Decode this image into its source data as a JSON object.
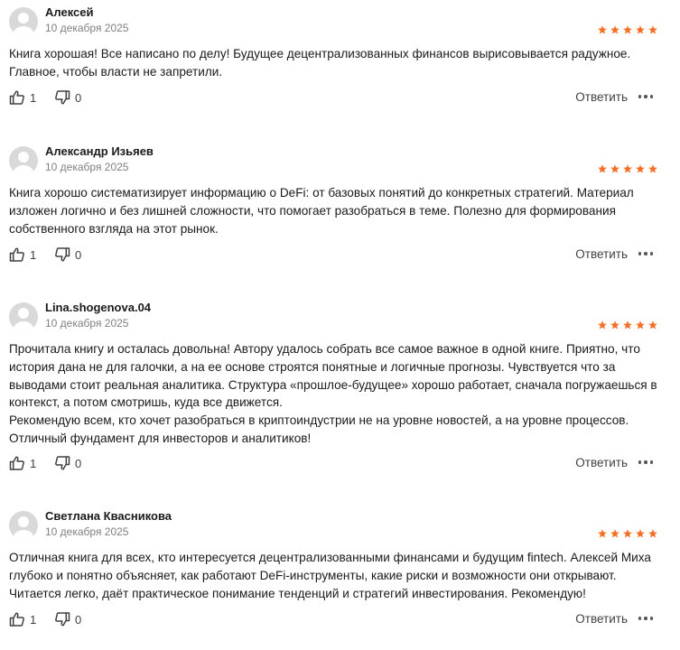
{
  "reviews": [
    {
      "author": "Алексей",
      "date": "10 декабря 2025",
      "rating": 5,
      "paragraphs": [
        "Книга хорошая! Все написано по делу! Будущее децентрализованных финансов вырисовывается радужное. Главное, чтобы власти не запретили."
      ],
      "likes": "1",
      "dislikes": "0",
      "reply_label": "Ответить"
    },
    {
      "author": "Александр Изьяев",
      "date": "10 декабря 2025",
      "rating": 5,
      "paragraphs": [
        "Книга хорошо систематизирует информацию о DeFi: от базовых понятий до конкретных стратегий. Материал изложен логично и без лишней сложности, что помогает разобраться в теме. Полезно для формирования собственного взгляда на этот рынок."
      ],
      "likes": "1",
      "dislikes": "0",
      "reply_label": "Ответить"
    },
    {
      "author": "Lina.shogenova.04",
      "date": "10 декабря 2025",
      "rating": 5,
      "paragraphs": [
        "Прочитала книгу и осталась довольна! Автору удалось собрать все самое важное в одной книге. Приятно, что история дана не для галочки, а на ее основе строятся понятные и логичные прогнозы. Чувствуется что за выводами стоит реальная аналитика. Структура «прошлое-будущее» хорошо работает, сначала погружаешься в контекст, а потом смотришь, куда все движется.",
        "Рекомендую всем, кто хочет разобраться в криптоиндустрии не на уровне новостей, а на уровне процессов.",
        "Отличный фундамент для инвесторов и аналитиков!"
      ],
      "likes": "1",
      "dislikes": "0",
      "reply_label": "Ответить"
    },
    {
      "author": "Светлана Квасникова",
      "date": "10 декабря 2025",
      "rating": 5,
      "paragraphs": [
        "Отличная книга для всех, кто интересуется децентрализованными финансами и будущим fintech. Алексей Миха глубоко и понятно объясняет, как работают DeFi-инструменты, какие риски и возможности они открывают. Читается легко, даёт практическое понимание тенденций и стратегий инвестирования. Рекомендую!"
      ],
      "likes": "1",
      "dislikes": "0",
      "reply_label": "Ответить"
    }
  ],
  "colors": {
    "star": "#ff6b1a",
    "avatar_bg": "#d9d9d9",
    "avatar_fg": "#ffffff",
    "text": "#1a1a1a",
    "muted": "#808080",
    "action": "#404040"
  },
  "icons": {
    "avatar": "avatar-placeholder-icon",
    "like": "thumbs-up-icon",
    "dislike": "thumbs-down-icon",
    "star": "star-icon",
    "more": "more-dots-icon"
  }
}
